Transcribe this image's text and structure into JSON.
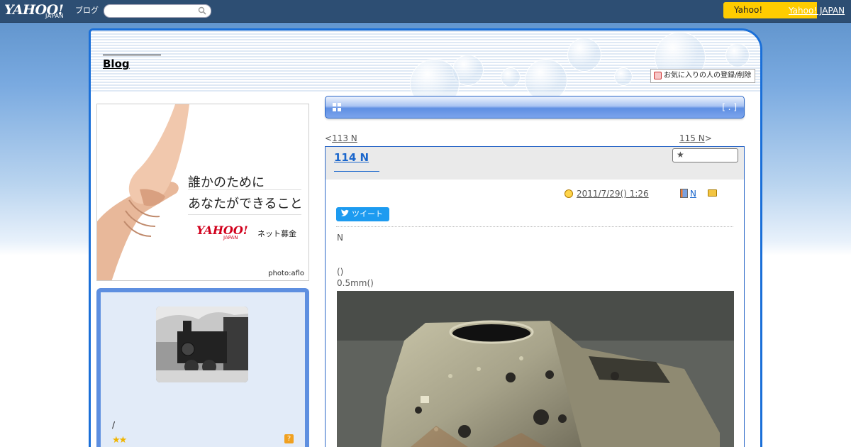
{
  "topbar": {
    "logo_main": "YAHOO!",
    "logo_sub": "JAPAN",
    "logo_blog": "ブログ",
    "search_placeholder": "",
    "yj_button": "Yahoo!",
    "yj_link": "Yahoo! JAPAN"
  },
  "header": {
    "blog_title": "Blog",
    "fav_button": "お気に入りの人の登録/削除"
  },
  "ad": {
    "line1": "誰かのために",
    "line2": "あなたができること",
    "logo": "YAHOO!",
    "logo_sub": "JAPAN",
    "service": "ネット募金",
    "credit": "photo:aflo"
  },
  "profile": {
    "slash_text": "/",
    "stars": "★★",
    "help": "?"
  },
  "main": {
    "bar_bracket": "[ . ]",
    "prev_arrow": "<",
    "prev_link": "113  N",
    "next_link": "115  N",
    "next_arrow": ">",
    "title": "114  N",
    "date": "2011/7/29()  1:26",
    "category": "N",
    "folder": "",
    "tweet": "ツイート",
    "body_n": "N",
    "body_paren": "()",
    "body_mm": "0.5mm()"
  },
  "colors": {
    "accent": "#1a6fd8",
    "topbar": "#2d4e73",
    "yj_yellow": "#ffcc00",
    "link": "#1a66cc"
  }
}
